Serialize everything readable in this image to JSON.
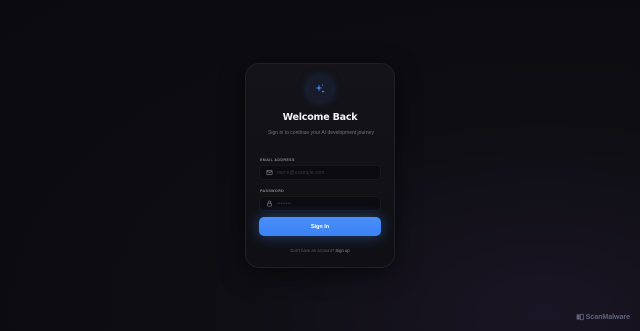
{
  "card": {
    "title": "Welcome Back",
    "subtitle": "Sign in to continue your AI development journey"
  },
  "form": {
    "email_label": "EMAIL ADDRESS",
    "email_placeholder": "name@example.com",
    "password_label": "PASSWORD",
    "password_placeholder": "••••••••",
    "submit_label": "Sign In"
  },
  "footer": {
    "prompt": "Don't have an account?",
    "link": "Sign up"
  },
  "watermark": {
    "text": "ScanMalware"
  },
  "icons": {
    "logo": "sparkles-icon",
    "email": "mail-icon",
    "password": "lock-icon"
  },
  "colors": {
    "accent": "#3b82f6",
    "background": "#0b0b0f",
    "card": "#121216"
  }
}
